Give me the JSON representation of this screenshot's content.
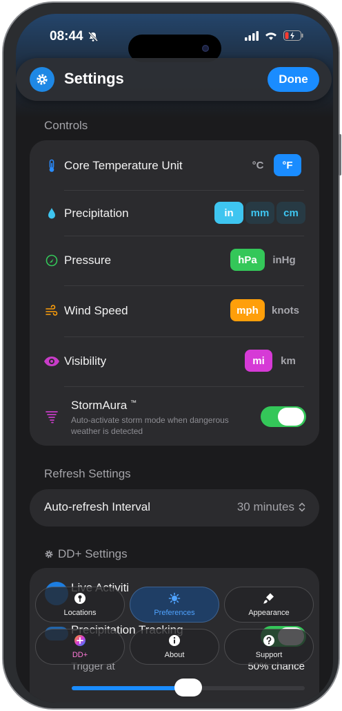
{
  "status": {
    "time": "08:44"
  },
  "header": {
    "title": "Settings",
    "done_label": "Done"
  },
  "controls": {
    "section_title": "Controls",
    "rows": [
      {
        "label": "Core Temperature Unit",
        "options": [
          "°C",
          "°F"
        ],
        "selected": "°F",
        "color": "#1a8cff"
      },
      {
        "label": "Precipitation",
        "options": [
          "in",
          "mm",
          "cm"
        ],
        "selected": "in",
        "color": "#3ec5f0"
      },
      {
        "label": "Pressure",
        "options": [
          "hPa",
          "inHg"
        ],
        "selected": "hPa",
        "color": "#34c759"
      },
      {
        "label": "Wind Speed",
        "options": [
          "mph",
          "knots"
        ],
        "selected": "mph",
        "color": "#ff9f0a"
      },
      {
        "label": "Visibility",
        "options": [
          "mi",
          "km"
        ],
        "selected": "mi",
        "color": "#d63ad6"
      }
    ],
    "stormaura": {
      "title": "StormAura",
      "tm": "™",
      "description_line1": "Auto-activate storm mode when dangerous",
      "description_line2": "weather is detected",
      "enabled": true
    }
  },
  "refresh": {
    "section_title": "Refresh Settings",
    "label": "Auto-refresh Interval",
    "value": "30 minutes"
  },
  "ddplus": {
    "section_title": "DD+ Settings",
    "live_activities_label": "Live Activiti",
    "precip_tracking_label": "Precipitation Tracking",
    "trigger_label": "Trigger at",
    "trigger_value": "50% chance",
    "trigger_percent": 50
  },
  "tabs": [
    {
      "label": "Locations",
      "icon": "pin-icon",
      "active": false
    },
    {
      "label": "Preferences",
      "icon": "sun-gear-icon",
      "active": true
    },
    {
      "label": "Appearance",
      "icon": "paintbrush-icon",
      "active": false
    },
    {
      "label": "DD+",
      "icon": "plus-circle-icon",
      "active": false
    },
    {
      "label": "About",
      "icon": "info-icon",
      "active": false
    },
    {
      "label": "Support",
      "icon": "question-icon",
      "active": false
    }
  ],
  "colors": {
    "accent": "#1a8cff",
    "toggle_on": "#34c759"
  }
}
